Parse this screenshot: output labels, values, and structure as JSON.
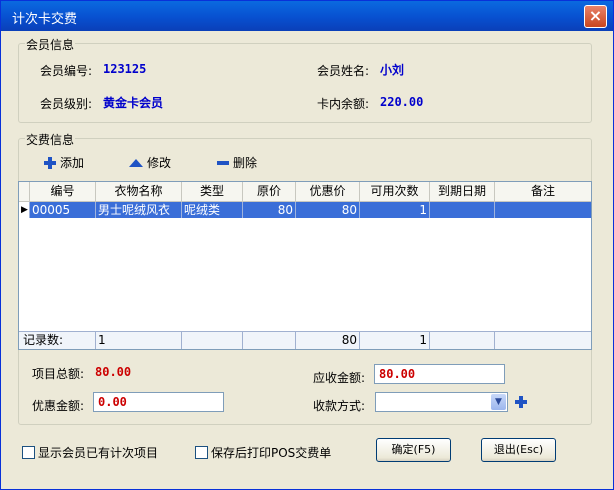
{
  "window": {
    "title": "计次卡交费",
    "close_glyph": "×"
  },
  "member": {
    "legend": "会员信息",
    "id_label": "会员编号:",
    "id_value": "123125",
    "name_label": "会员姓名:",
    "name_value": "小刘",
    "level_label": "会员级别:",
    "level_value": "黄金卡会员",
    "balance_label": "卡内余额:",
    "balance_value": "220.00"
  },
  "payment": {
    "legend": "交费信息",
    "toolbar": {
      "add": "添加",
      "edit": "修改",
      "delete": "删除"
    },
    "columns": [
      "编号",
      "衣物名称",
      "类型",
      "原价",
      "优惠价",
      "可用次数",
      "到期日期",
      "备注"
    ],
    "rows": [
      {
        "id": "00005",
        "name": "男士呢绒风衣",
        "type": "呢绒类",
        "price": "80",
        "discount_price": "80",
        "times": "1",
        "expire": "",
        "note": ""
      }
    ],
    "footer": {
      "label": "记录数:",
      "count": "1",
      "discount_total": "80",
      "times_total": "1"
    }
  },
  "summary": {
    "total_label": "项目总额:",
    "total_value": "80.00",
    "discount_label": "优惠金额:",
    "discount_value": "0.00",
    "receivable_label": "应收金额:",
    "receivable_value": "80.00",
    "method_label": "收款方式:",
    "method_value": ""
  },
  "options": {
    "show_existing": "显示会员已有计次项目",
    "print_after_save": "保存后打印POS交费单"
  },
  "buttons": {
    "ok": "确定(F5)",
    "exit": "退出(Esc)"
  }
}
